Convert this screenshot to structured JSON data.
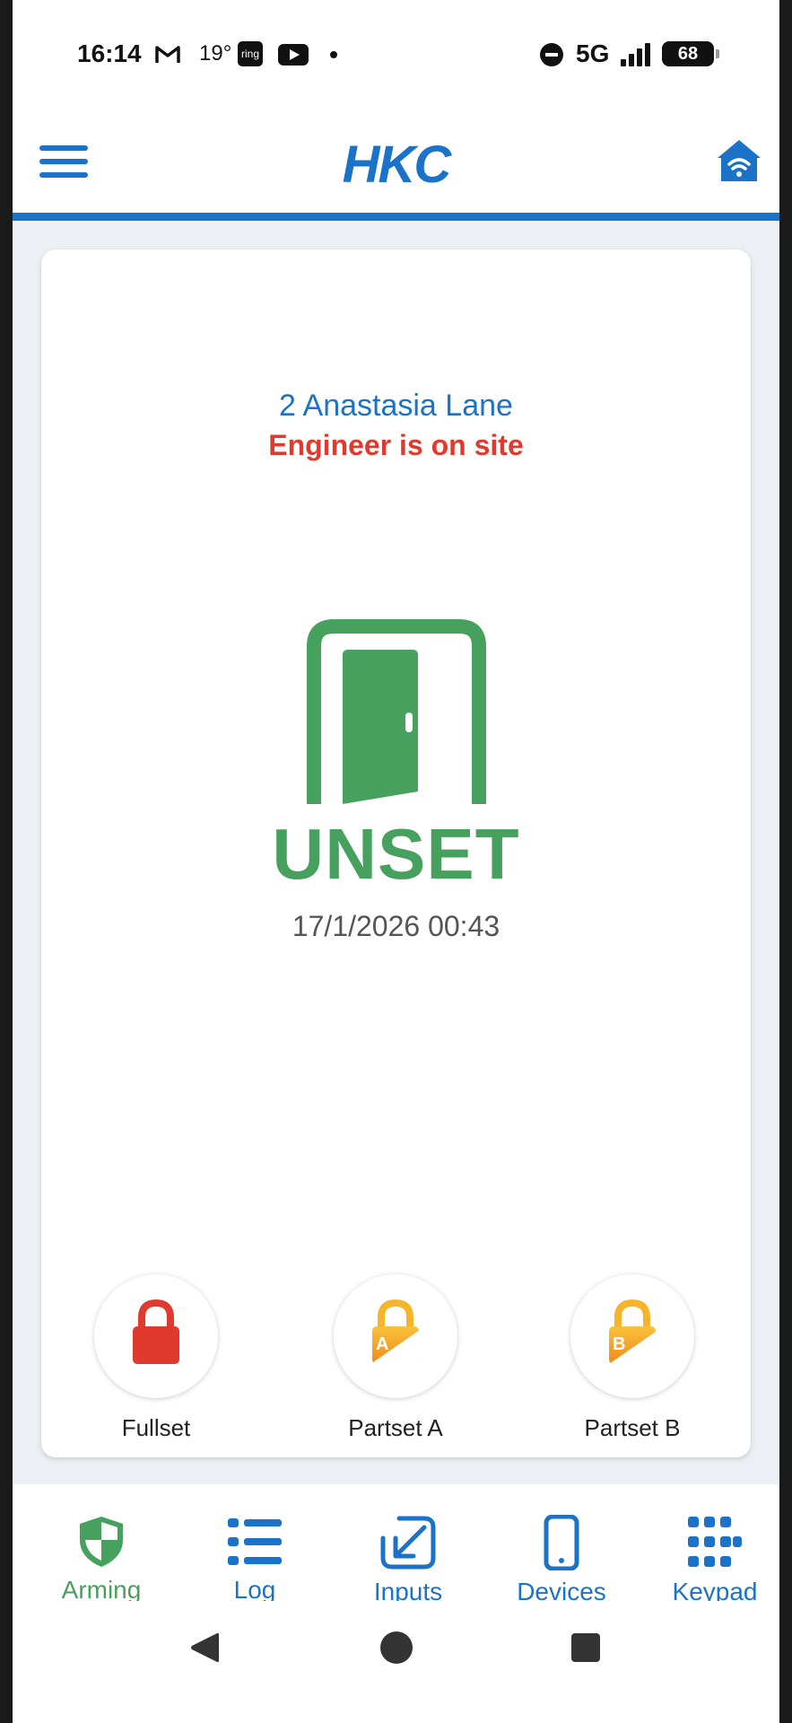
{
  "status_bar": {
    "time": "16:14",
    "temperature": "19°",
    "ring_label": "ring",
    "network": "5G",
    "battery": "68"
  },
  "header": {
    "logo": "HKC"
  },
  "site": {
    "name": "2 Anastasia Lane",
    "status_message": "Engineer is on site"
  },
  "system_state": {
    "label": "UNSET",
    "timestamp": "17/1/2026 00:43",
    "color": "#46a05e"
  },
  "arm_actions": [
    {
      "label": "Fullset",
      "icon": "red-padlock-icon",
      "color": "#e03a2f"
    },
    {
      "label": "Partset A",
      "icon": "padlock-a-icon",
      "color": "#f5a623",
      "badge": "A"
    },
    {
      "label": "Partset B",
      "icon": "padlock-b-icon",
      "color": "#f5a623",
      "badge": "B"
    }
  ],
  "bottom_nav": [
    {
      "label": "Arming",
      "icon": "shield-icon",
      "active": true
    },
    {
      "label": "Log",
      "icon": "list-icon",
      "active": false
    },
    {
      "label": "Inputs",
      "icon": "input-arrow-icon",
      "active": false
    },
    {
      "label": "Devices",
      "icon": "phone-icon",
      "active": false
    },
    {
      "label": "Keypad",
      "icon": "keypad-icon",
      "active": false
    }
  ],
  "colors": {
    "brand_blue": "#1a73c8",
    "alert_red": "#e03a2f",
    "unset_green": "#46a05e"
  }
}
